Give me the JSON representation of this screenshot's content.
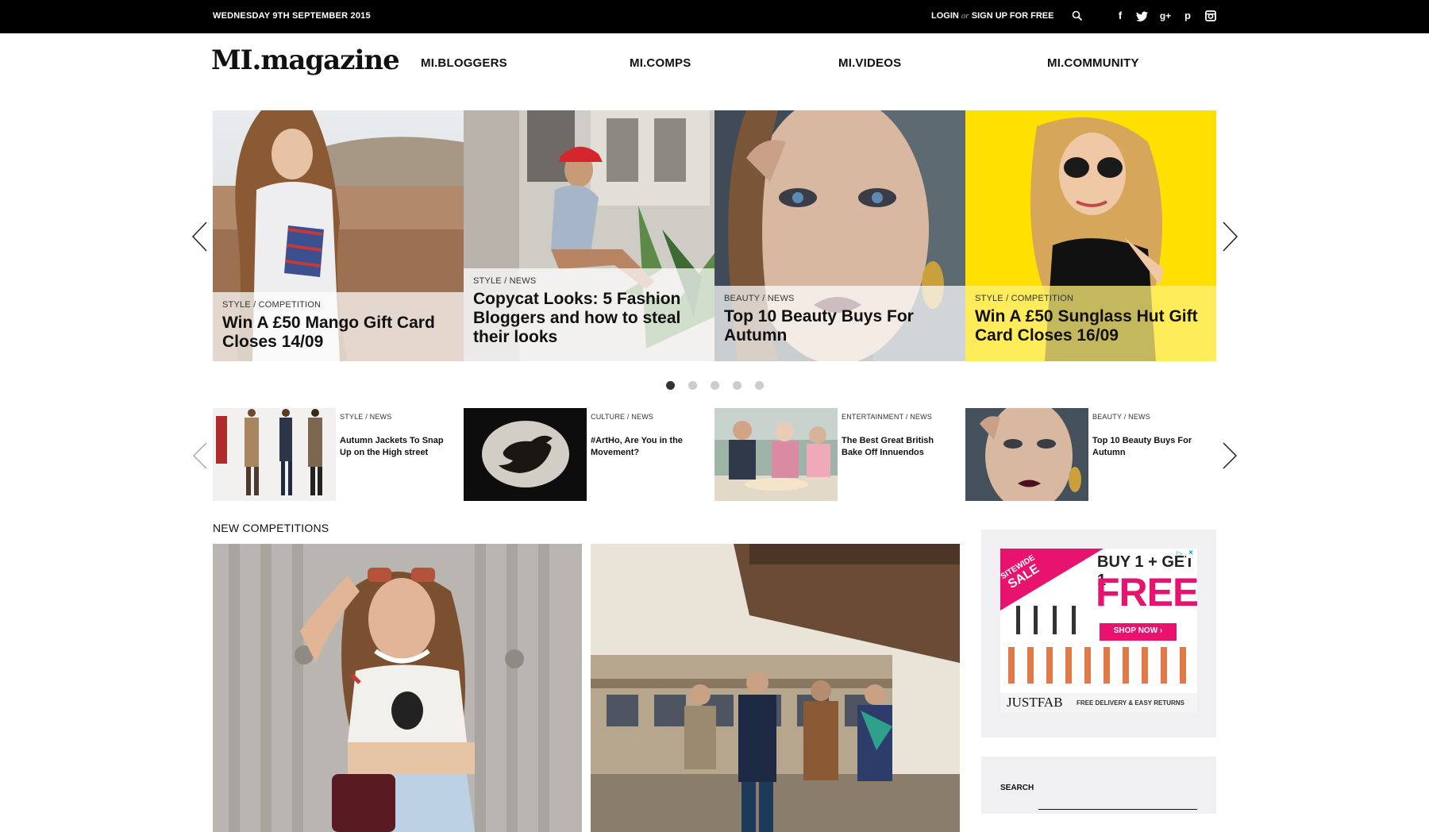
{
  "topbar": {
    "date": "WEDNESDAY 9TH SEPTEMBER 2015",
    "login": "LOGIN",
    "or": "or",
    "signup": "SIGN UP FOR FREE",
    "icons": [
      "search-icon",
      "facebook-icon",
      "twitter-icon",
      "google-plus-icon",
      "pinterest-icon",
      "instagram-icon"
    ]
  },
  "header": {
    "logo": "MI.magazine",
    "nav": [
      "MI.BLOGGERS",
      "MI.COMPS",
      "MI.VIDEOS",
      "MI.COMMUNITY"
    ]
  },
  "carousel": {
    "slides": [
      {
        "category": "STYLE / COMPETITION",
        "title": "Win A £50 Mango Gift Card Closes 14/09"
      },
      {
        "category": "STYLE / NEWS",
        "title": "Copycat Looks: 5 Fashion Bloggers and how to steal their looks"
      },
      {
        "category": "BEAUTY / NEWS",
        "title": "Top 10 Beauty Buys For Autumn"
      },
      {
        "category": "STYLE / COMPETITION",
        "title": "Win A £50 Sunglass Hut Gift Card Closes 16/09"
      }
    ],
    "dots": 5,
    "active_dot": 0
  },
  "thumbs": [
    {
      "category": "STYLE / NEWS",
      "title": "Autumn Jackets To Snap Up on the High street"
    },
    {
      "category": "CULTURE / NEWS",
      "title": "#ArtHo, Are You in the Movement?"
    },
    {
      "category": "ENTERTAINMENT / NEWS",
      "title": "The Best Great British Bake Off Innuendos"
    },
    {
      "category": "BEAUTY / NEWS",
      "title": "Top 10 Beauty Buys For Autumn"
    }
  ],
  "competitions": {
    "heading": "NEW COMPETITIONS"
  },
  "ad": {
    "badge_line1": "SITEWIDE",
    "badge_line2": "SALE",
    "headline": "BUY 1 + GET 1",
    "free": "FREE",
    "asterisk": "*",
    "cta": "SHOP NOW ›",
    "brand": "JUSTFAB",
    "footer": "FREE DELIVERY & EASY RETURNS"
  },
  "sidebar_search": {
    "label": "SEARCH",
    "value": ""
  },
  "colors": {
    "topbar": "#000000",
    "yellow_slide": "#ffe000",
    "ad_pink": "#e8126f",
    "sidebar_bg": "#f0f0f2"
  }
}
